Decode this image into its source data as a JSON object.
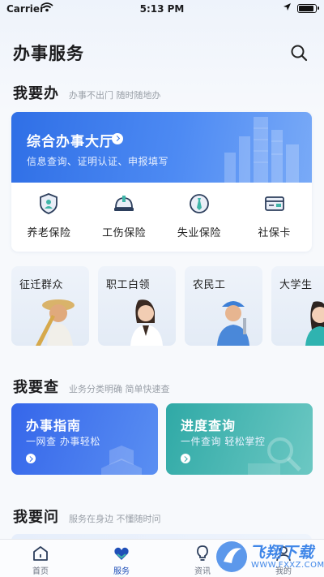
{
  "status_bar": {
    "carrier": "Carrier",
    "time": "5:13 PM"
  },
  "page": {
    "title": "办事服务"
  },
  "section_do": {
    "title": "我要办",
    "subtitle": "办事不出门 随时随地办"
  },
  "hall": {
    "title": "综合办事大厅",
    "subtitle": "信息查询、证明认证、申报填写",
    "services": [
      {
        "label": "养老保险",
        "icon": "shield-person-icon"
      },
      {
        "label": "工伤保险",
        "icon": "hard-hat-icon"
      },
      {
        "label": "失业保险",
        "icon": "tie-badge-icon"
      },
      {
        "label": "社保卡",
        "icon": "id-card-icon"
      }
    ]
  },
  "people": [
    {
      "label": "征迁群众"
    },
    {
      "label": "职工白领"
    },
    {
      "label": "农民工"
    },
    {
      "label": "大学生"
    }
  ],
  "section_check": {
    "title": "我要查",
    "subtitle": "业务分类明确 简单快速查"
  },
  "query_cards": [
    {
      "title": "办事指南",
      "subtitle": "一网查 办事轻松",
      "color": "#3d6ff0"
    },
    {
      "title": "进度查询",
      "subtitle": "一件查询 轻松掌控",
      "color": "#3ab0ad"
    }
  ],
  "section_ask": {
    "title": "我要问",
    "subtitle": "服务在身边 不懂随时问"
  },
  "tabbar": {
    "items": [
      {
        "label": "首页",
        "icon": "home-icon",
        "active": false
      },
      {
        "label": "服务",
        "icon": "heart-service-icon",
        "active": true
      },
      {
        "label": "资讯",
        "icon": "bulb-icon",
        "active": false
      },
      {
        "label": "我的",
        "icon": "user-icon",
        "active": false
      }
    ]
  },
  "watermark": {
    "text": "飞翔下载",
    "url": "WWW.FXXZ.COM"
  },
  "colors": {
    "accent": "#2f6fe6",
    "tab_active": "#1f4fb8",
    "teal": "#3ab0ad"
  }
}
